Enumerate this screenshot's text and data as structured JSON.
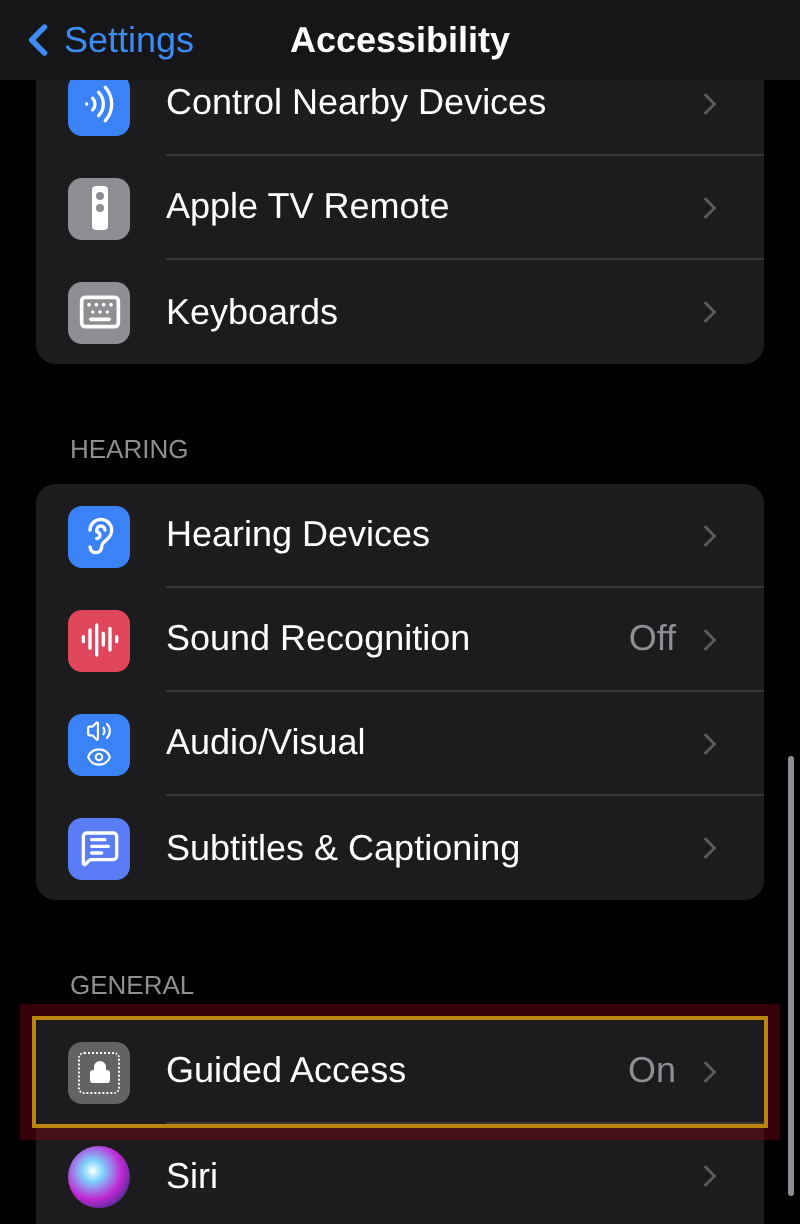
{
  "nav_bar": {
    "back_label": "Settings",
    "title": "Accessibility"
  },
  "sections": [
    {
      "items": [
        {
          "kind": "nearby",
          "label": "Control Nearby Devices",
          "highlighted": false
        },
        {
          "kind": "remote",
          "label": "Apple TV Remote",
          "highlighted": false
        },
        {
          "kind": "keyboard",
          "label": "Keyboards",
          "highlighted": false
        }
      ]
    },
    {
      "header": "HEARING",
      "items": [
        {
          "kind": "ear",
          "label": "Hearing Devices",
          "highlighted": false
        },
        {
          "kind": "sound",
          "label": "Sound Recognition",
          "value": "Off",
          "highlighted": false
        },
        {
          "kind": "audiovisual",
          "label": "Audio/Visual",
          "highlighted": false
        },
        {
          "kind": "subtitles",
          "label": "Subtitles & Captioning",
          "highlighted": false
        }
      ]
    },
    {
      "header": "GENERAL",
      "items": [
        {
          "kind": "lock",
          "label": "Guided Access",
          "value": "On",
          "highlighted": true
        },
        {
          "kind": "siri",
          "label": "Siri",
          "highlighted": false
        }
      ]
    }
  ]
}
